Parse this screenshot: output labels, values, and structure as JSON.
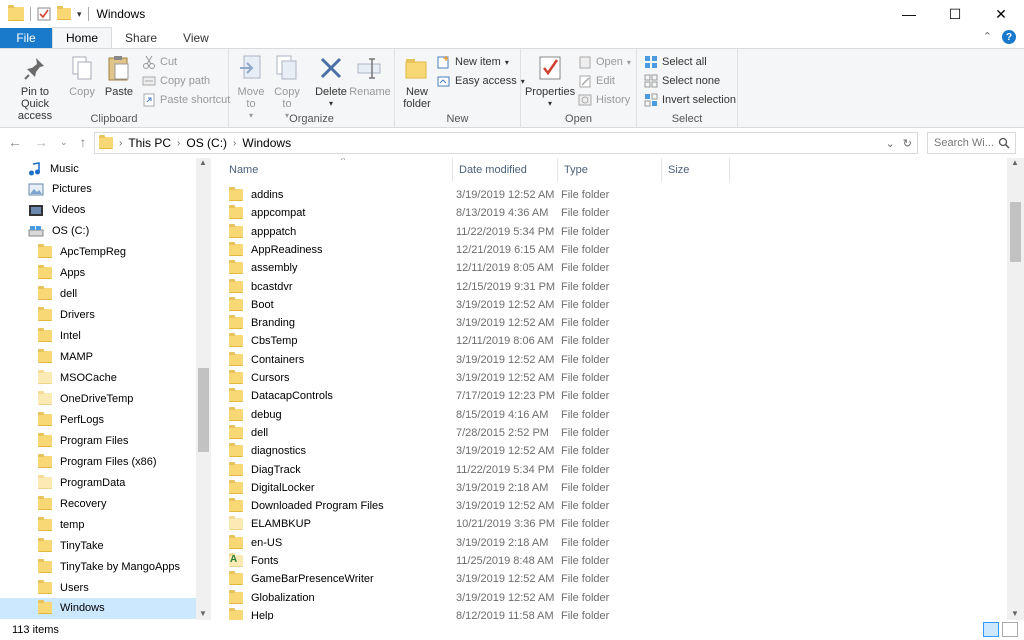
{
  "window": {
    "title": "Windows",
    "controls": {
      "minimize": "—",
      "maximize": "☐",
      "close": "✕"
    }
  },
  "tabs": [
    {
      "label": "File"
    },
    {
      "label": "Home"
    },
    {
      "label": "Share"
    },
    {
      "label": "View"
    }
  ],
  "ribbon": {
    "clipboard": {
      "label": "Clipboard",
      "pin": "Pin to Quick access",
      "copy": "Copy",
      "paste": "Paste",
      "cut": "Cut",
      "copy_path": "Copy path",
      "paste_shortcut": "Paste shortcut"
    },
    "organize": {
      "label": "Organize",
      "move_to": "Move to",
      "copy_to": "Copy to",
      "delete": "Delete",
      "rename": "Rename"
    },
    "new": {
      "label": "New",
      "new_folder": "New folder",
      "new_item": "New item",
      "easy_access": "Easy access"
    },
    "open": {
      "label": "Open",
      "properties": "Properties",
      "open": "Open",
      "edit": "Edit",
      "history": "History"
    },
    "select": {
      "label": "Select",
      "select_all": "Select all",
      "select_none": "Select none",
      "invert": "Invert selection"
    }
  },
  "address": {
    "crumbs": [
      "This PC",
      "OS (C:)",
      "Windows"
    ],
    "search_placeholder": "Search Wi..."
  },
  "nav": {
    "items": [
      {
        "label": "Music",
        "icon": "music-icon"
      },
      {
        "label": "Pictures",
        "icon": "pictures-icon"
      },
      {
        "label": "Videos",
        "icon": "videos-icon"
      },
      {
        "label": "OS (C:)",
        "icon": "drive-icon"
      },
      {
        "label": "ApcTempReg",
        "icon": "folder-icon"
      },
      {
        "label": "Apps",
        "icon": "folder-icon"
      },
      {
        "label": "dell",
        "icon": "folder-icon"
      },
      {
        "label": "Drivers",
        "icon": "folder-icon"
      },
      {
        "label": "Intel",
        "icon": "folder-icon"
      },
      {
        "label": "MAMP",
        "icon": "folder-icon"
      },
      {
        "label": "MSOCache",
        "icon": "folder-icon"
      },
      {
        "label": "OneDriveTemp",
        "icon": "folder-icon"
      },
      {
        "label": "PerfLogs",
        "icon": "folder-icon"
      },
      {
        "label": "Program Files",
        "icon": "folder-icon"
      },
      {
        "label": "Program Files (x86)",
        "icon": "folder-icon"
      },
      {
        "label": "ProgramData",
        "icon": "folder-icon"
      },
      {
        "label": "Recovery",
        "icon": "folder-icon"
      },
      {
        "label": "temp",
        "icon": "folder-icon"
      },
      {
        "label": "TinyTake",
        "icon": "folder-icon"
      },
      {
        "label": "TinyTake by MangoApps",
        "icon": "folder-icon"
      },
      {
        "label": "Users",
        "icon": "folder-icon"
      },
      {
        "label": "Windows",
        "icon": "folder-icon"
      }
    ]
  },
  "columns": {
    "name": "Name",
    "date": "Date modified",
    "type": "Type",
    "size": "Size"
  },
  "files": [
    {
      "name": "addins",
      "date": "3/19/2019 12:52 AM",
      "type": "File folder"
    },
    {
      "name": "appcompat",
      "date": "8/13/2019 4:36 AM",
      "type": "File folder"
    },
    {
      "name": "apppatch",
      "date": "11/22/2019 5:34 PM",
      "type": "File folder"
    },
    {
      "name": "AppReadiness",
      "date": "12/21/2019 6:15 AM",
      "type": "File folder"
    },
    {
      "name": "assembly",
      "date": "12/11/2019 8:05 AM",
      "type": "File folder"
    },
    {
      "name": "bcastdvr",
      "date": "12/15/2019 9:31 PM",
      "type": "File folder"
    },
    {
      "name": "Boot",
      "date": "3/19/2019 12:52 AM",
      "type": "File folder"
    },
    {
      "name": "Branding",
      "date": "3/19/2019 12:52 AM",
      "type": "File folder"
    },
    {
      "name": "CbsTemp",
      "date": "12/11/2019 8:06 AM",
      "type": "File folder"
    },
    {
      "name": "Containers",
      "date": "3/19/2019 12:52 AM",
      "type": "File folder"
    },
    {
      "name": "Cursors",
      "date": "3/19/2019 12:52 AM",
      "type": "File folder"
    },
    {
      "name": "DatacapControls",
      "date": "7/17/2019 12:23 PM",
      "type": "File folder"
    },
    {
      "name": "debug",
      "date": "8/15/2019 4:16 AM",
      "type": "File folder"
    },
    {
      "name": "dell",
      "date": "7/28/2015 2:52 PM",
      "type": "File folder"
    },
    {
      "name": "diagnostics",
      "date": "3/19/2019 12:52 AM",
      "type": "File folder"
    },
    {
      "name": "DiagTrack",
      "date": "11/22/2019 5:34 PM",
      "type": "File folder"
    },
    {
      "name": "DigitalLocker",
      "date": "3/19/2019 2:18 AM",
      "type": "File folder"
    },
    {
      "name": "Downloaded Program Files",
      "date": "3/19/2019 12:52 AM",
      "type": "File folder"
    },
    {
      "name": "ELAMBKUP",
      "date": "10/21/2019 3:36 PM",
      "type": "File folder"
    },
    {
      "name": "en-US",
      "date": "3/19/2019 2:18 AM",
      "type": "File folder"
    },
    {
      "name": "Fonts",
      "date": "11/25/2019 8:48 AM",
      "type": "File folder"
    },
    {
      "name": "GameBarPresenceWriter",
      "date": "3/19/2019 12:52 AM",
      "type": "File folder"
    },
    {
      "name": "Globalization",
      "date": "3/19/2019 12:52 AM",
      "type": "File folder"
    },
    {
      "name": "Help",
      "date": "8/12/2019 11:58 AM",
      "type": "File folder"
    }
  ],
  "status": {
    "count": "113 items"
  }
}
